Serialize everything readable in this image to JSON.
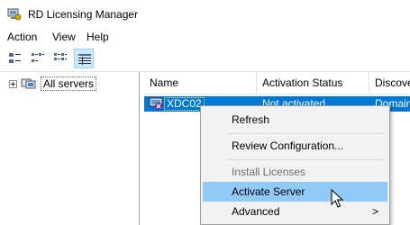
{
  "window": {
    "title": "RD Licensing Manager"
  },
  "menubar": {
    "items": [
      "Action",
      "View",
      "Help"
    ]
  },
  "toolbar": {
    "buttons": [
      {
        "icon": "large-icons-view-icon",
        "active": false
      },
      {
        "icon": "small-icons-view-icon",
        "active": false
      },
      {
        "icon": "list-view-icon",
        "active": false
      },
      {
        "icon": "details-view-icon",
        "active": true
      }
    ]
  },
  "tree": {
    "root_label": "All servers"
  },
  "list": {
    "columns": [
      "Name",
      "Activation Status",
      "Discove"
    ],
    "rows": [
      {
        "name": "XDC02",
        "status": "Not activated",
        "discovery": "Domain"
      }
    ]
  },
  "context_menu": {
    "items": [
      {
        "label": "Refresh",
        "enabled": true
      },
      {
        "label": "Review Configuration...",
        "enabled": true
      },
      {
        "label": "Install Licenses",
        "enabled": false
      },
      {
        "label": "Activate Server",
        "enabled": true,
        "highlighted": true
      },
      {
        "label": "Advanced",
        "enabled": true,
        "submenu_arrow": ">"
      }
    ]
  },
  "colors": {
    "selection": "#0078d7",
    "menu_highlight": "#91c9f7",
    "toolbar_active": "#cce8ff"
  }
}
